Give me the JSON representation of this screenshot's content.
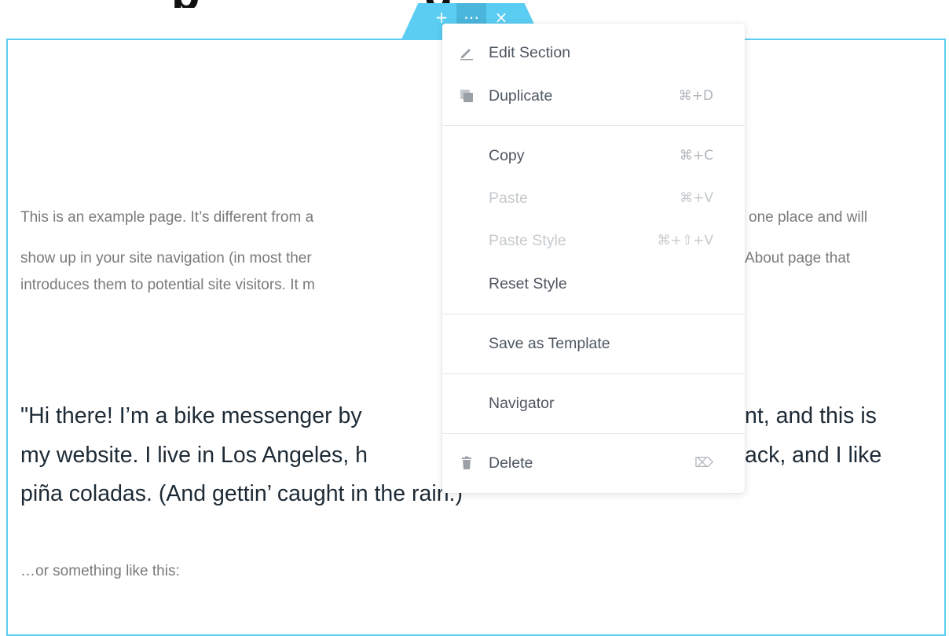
{
  "heading": {
    "fragment_left": "p",
    "fragment_right": "g"
  },
  "handle": {
    "add_symbol": "+",
    "edit_symbol": "⋯",
    "close_symbol": "×"
  },
  "content": {
    "paragraph_line1_left": "This is an example page. It’s different from a",
    "paragraph_line1_right": "one place and will",
    "paragraph_line2_left": "show up in your site navigation (in most ther",
    "paragraph_line2_right": "About page that",
    "paragraph_line3_left": "introduces them to potential site visitors. It m",
    "quote_line1_left": "\"Hi there! I’m a bike messenger by",
    "quote_line1_right": "nt, and this is",
    "quote_line2_left": "my website. I live in Los Angeles, h",
    "quote_line2_right": "ack, and I like",
    "quote_line3": "piña coladas. (And gettin’ caught in the rain.)",
    "tail": "…or something like this:"
  },
  "context_menu": {
    "items": [
      {
        "label": "Edit Section",
        "shortcut": "",
        "icon": "pencil-icon",
        "disabled": false
      },
      {
        "label": "Duplicate",
        "shortcut": "⌘+D",
        "icon": "duplicate-icon",
        "disabled": false
      },
      {
        "label": "Copy",
        "shortcut": "⌘+C",
        "icon": "",
        "disabled": false
      },
      {
        "label": "Paste",
        "shortcut": "⌘+V",
        "icon": "",
        "disabled": true
      },
      {
        "label": "Paste Style",
        "shortcut": "⌘+⇧+V",
        "icon": "",
        "disabled": true
      },
      {
        "label": "Reset Style",
        "shortcut": "",
        "icon": "",
        "disabled": false
      },
      {
        "label": "Save as Template",
        "shortcut": "",
        "icon": "",
        "disabled": false
      },
      {
        "label": "Navigator",
        "shortcut": "",
        "icon": "",
        "disabled": false
      },
      {
        "label": "Delete",
        "shortcut": "⌦",
        "icon": "trash-icon",
        "disabled": false
      }
    ]
  },
  "colors": {
    "accent": "#5bcdf2",
    "menu_text": "#4e5660",
    "disabled_text": "#c6cacd"
  }
}
